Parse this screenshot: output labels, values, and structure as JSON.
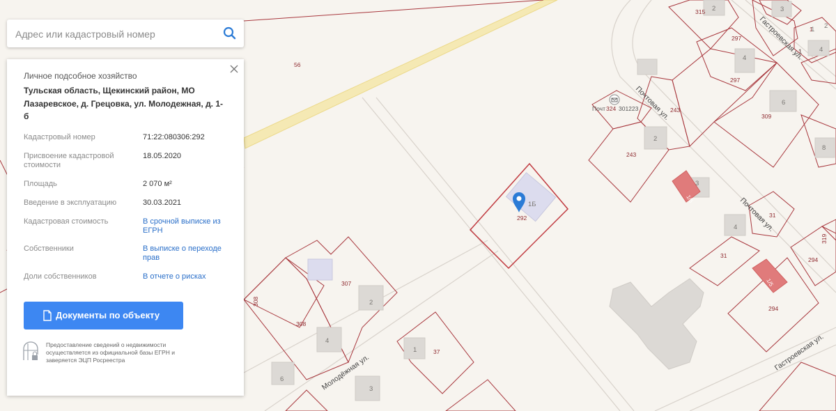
{
  "search": {
    "placeholder": "Адрес или кадастровый номер"
  },
  "icons": {
    "search": "search-icon",
    "close": "close-icon",
    "document": "document-icon",
    "building_lock": "building-lock-icon",
    "map_pin": "map-pin-icon",
    "post_office": "post-office-icon"
  },
  "colors": {
    "accent": "#3d87f2",
    "link": "#2a6fc9",
    "parcel_border": "#a8373d",
    "selected_parcel": "#c0393f",
    "building": "#dcd9d5",
    "selected_building": "#dcdcee",
    "pin": "#2b7bd6",
    "road": "#f5e9b4",
    "highlight_building": "#e07b7b"
  },
  "info_panel": {
    "object_type": "Личное подсобное хозяйство",
    "address": "Тульская область, Щекинский район, МО Лазаревское, д. Грецовка, ул. Молодежная, д. 1-б",
    "rows": [
      {
        "label": "Кадастровый номер",
        "value": "71:22:080306:292"
      },
      {
        "label": "Присвоение кадастровой стоимости",
        "value": "18.05.2020"
      },
      {
        "label": "Площадь",
        "value": "2 070 м²"
      },
      {
        "label": "Введение в эксплуатацию",
        "value": "30.03.2021"
      },
      {
        "label": "Кадастровая стоимость",
        "value": "В срочной выписке из ЕГРН"
      },
      {
        "label": "Собственники",
        "value": "В выписке о переходе прав"
      },
      {
        "label": "Доли собственников",
        "value": "В отчете о рисках"
      }
    ],
    "documents_button": "Документы по объекту",
    "disclaimer": "Предоставление сведений о недвижимости осуществляется из официальной базы ЕГРН и заверяется ЭЦП Росреестра"
  },
  "map": {
    "streets": [
      "Гастроевская ул.",
      "Почтовая ул.",
      "Почтовая ул.",
      "Молодёжная ул.",
      "Гастроевская ул."
    ],
    "parcel_labels": [
      "56",
      "292",
      "243",
      "243",
      "297",
      "297",
      "309",
      "315",
      "31",
      "31",
      "294",
      "294",
      "307",
      "308",
      "308",
      "37",
      "324",
      "319",
      "1",
      "1"
    ],
    "house_numbers": [
      "2",
      "3",
      "4",
      "6",
      "8",
      "2",
      "3",
      "4",
      "1Б",
      "2",
      "4",
      "6",
      "3",
      "1",
      "2",
      "4",
      "1",
      "1"
    ],
    "poi": "Почт",
    "poi_code": "301223",
    "highlighted_buildings": [
      "1/5",
      "1/5"
    ]
  }
}
